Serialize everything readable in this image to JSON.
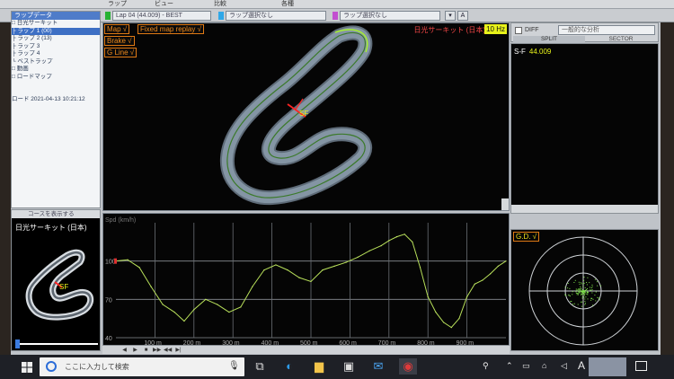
{
  "toolbar": {
    "lap_select": "Lap 04 (44.009) - BEST",
    "lap_compare": "ラップ選択なし",
    "lap_compare2": "ラップ選択なし",
    "zoom_label": "A",
    "colors": {
      "lap1": "#27b233",
      "lap2": "#2fa8e8",
      "lap3": "#c24fd0"
    }
  },
  "menu": {
    "items": [
      "ラップ",
      "ビュー",
      "比較",
      "各種"
    ]
  },
  "tree": {
    "header": "ラップデータ",
    "rows": [
      {
        "label": "□ 日光サーキット",
        "selected": false
      },
      {
        "label": "  ├ ラップ 1 (00)",
        "selected": true
      },
      {
        "label": "  ├ ラップ 2 (13)",
        "selected": false
      },
      {
        "label": "  ├ ラップ 3",
        "selected": false
      },
      {
        "label": "  ├ ラップ 4",
        "selected": false
      },
      {
        "label": "  └ ベストラップ",
        "selected": false
      },
      {
        "label": "□ 動画",
        "selected": false
      },
      {
        "label": "□ ロードマップ",
        "selected": false
      },
      {
        "label": "",
        "selected": false
      },
      {
        "label": "",
        "selected": false
      },
      {
        "label": "ロード 2021-04-13 10:21:12",
        "selected": false
      }
    ]
  },
  "minimap": {
    "header": "コースを表示する",
    "title": "日光サーキット (日本)",
    "sf_label": "SF"
  },
  "map": {
    "buttons": {
      "map": "Map √",
      "fixed_replay": "Fixed map replay √",
      "brake": "Brake √",
      "gline": "G Line √"
    },
    "circuit_label": "日光サーキット (日本)",
    "freq": "10 Hz",
    "sf_label": "SF"
  },
  "graph": {
    "ylabel": "Spd (km/h)",
    "y_ticks": [
      "100",
      "70",
      "40"
    ],
    "x_ticks": [
      "100 m",
      "200 m",
      "300 m",
      "400 m",
      "500 m",
      "600 m",
      "700 m",
      "800 m",
      "900 m"
    ]
  },
  "chart_data": {
    "type": "line",
    "ylabel": "Spd (km/h)",
    "ylim": [
      40,
      130
    ],
    "xlim": [
      0,
      1000
    ],
    "x": [
      0,
      30,
      60,
      90,
      120,
      150,
      175,
      200,
      230,
      260,
      290,
      320,
      350,
      380,
      410,
      440,
      470,
      500,
      530,
      560,
      590,
      620,
      650,
      680,
      700,
      720,
      740,
      760,
      780,
      800,
      820,
      840,
      860,
      880,
      900,
      920,
      940,
      960,
      980,
      1000
    ],
    "series": [
      {
        "values": [
          100,
          101,
          95,
          80,
          66,
          60,
          53,
          62,
          70,
          66,
          60,
          64,
          80,
          93,
          97,
          93,
          87,
          84,
          93,
          96,
          99,
          103,
          108,
          112,
          116,
          119,
          121,
          115,
          95,
          72,
          60,
          52,
          48,
          55,
          72,
          82,
          85,
          90,
          96,
          100
        ]
      }
    ]
  },
  "transport": {
    "buttons": [
      "◀",
      "▶",
      "■",
      "▶▶",
      "◀◀",
      "▶|"
    ]
  },
  "right": {
    "diff_label": "DIFF",
    "analysis_select": "一般的な分析",
    "tab_split": "SPLIT",
    "tab_sector": "SECTOR",
    "split_label": "S-F",
    "split_value": "44.009",
    "gd_button": "G.D. √"
  },
  "taskbar": {
    "search_placeholder": "ここに入力して検索",
    "tray_ime": "A"
  }
}
